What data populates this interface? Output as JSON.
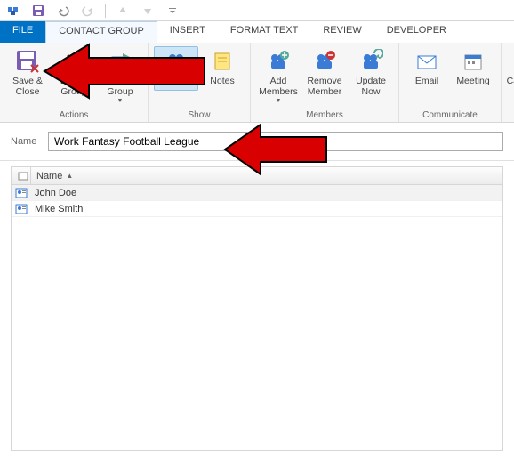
{
  "qat_icons": [
    "group-icon",
    "save-icon",
    "undo-icon",
    "redo-icon",
    "up-icon",
    "down-icon",
    "customize-icon"
  ],
  "tabs": {
    "file": "FILE",
    "contact_group": "CONTACT GROUP",
    "insert": "INSERT",
    "format_text": "FORMAT TEXT",
    "review": "REVIEW",
    "developer": "DEVELOPER"
  },
  "ribbon": {
    "actions": {
      "save_close": "Save &\nClose",
      "delete_group": "Delete\nGroup",
      "forward_group": "Forward\nGroup",
      "label": "Actions"
    },
    "show": {
      "members": "Members",
      "notes": "Notes",
      "label": "Show"
    },
    "members_grp": {
      "add_members": "Add\nMembers",
      "remove_member": "Remove\nMember",
      "update_now": "Update\nNow",
      "label": "Members"
    },
    "communicate": {
      "email": "Email",
      "meeting": "Meeting",
      "label": "Communicate"
    },
    "tags": {
      "categorize": "Categorize"
    }
  },
  "name_field": {
    "label": "Name",
    "value": "Work Fantasy Football League"
  },
  "list": {
    "header_name": "Name",
    "rows": [
      {
        "name": "John Doe"
      },
      {
        "name": "Mike Smith"
      }
    ]
  }
}
